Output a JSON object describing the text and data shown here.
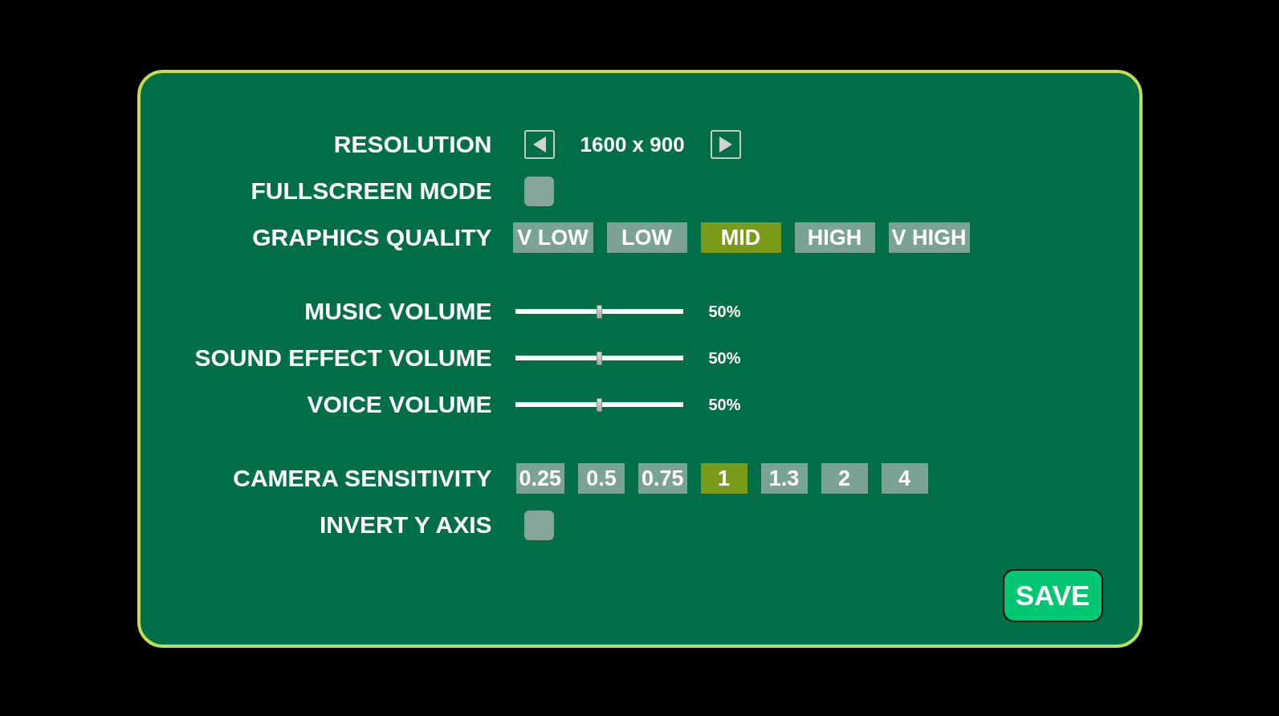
{
  "settings": [
    {
      "kind": "stepper",
      "label": "RESOLUTION",
      "value": "1600 x 900"
    },
    {
      "kind": "checkbox",
      "label": "FULLSCREEN MODE",
      "checked": false
    },
    {
      "kind": "choices",
      "label": "GRAPHICS QUALITY",
      "options": [
        {
          "label": "V LOW",
          "selected": false
        },
        {
          "label": "LOW",
          "selected": false
        },
        {
          "label": "MID",
          "selected": true
        },
        {
          "label": "HIGH",
          "selected": false
        },
        {
          "label": "V HIGH",
          "selected": false
        }
      ]
    },
    {
      "kind": "spacer"
    },
    {
      "kind": "slider",
      "label": "MUSIC VOLUME",
      "level": 0.5,
      "reading": "50%"
    },
    {
      "kind": "slider",
      "label": "SOUND EFFECT VOLUME",
      "level": 0.5,
      "reading": "50%"
    },
    {
      "kind": "slider",
      "label": "VOICE VOLUME",
      "level": 0.5,
      "reading": "50%"
    },
    {
      "kind": "spacer"
    },
    {
      "kind": "steps",
      "label": "CAMERA SENSITIVITY",
      "options": [
        {
          "label": "0.25",
          "selected": false
        },
        {
          "label": "0.5",
          "selected": false
        },
        {
          "label": "0.75",
          "selected": false
        },
        {
          "label": "1",
          "selected": true
        },
        {
          "label": "1.3",
          "selected": false
        },
        {
          "label": "2",
          "selected": false
        },
        {
          "label": "4",
          "selected": false
        }
      ]
    },
    {
      "kind": "checkbox",
      "label": "INVERT Y AXIS",
      "checked": false
    }
  ],
  "save_button": "SAVE"
}
